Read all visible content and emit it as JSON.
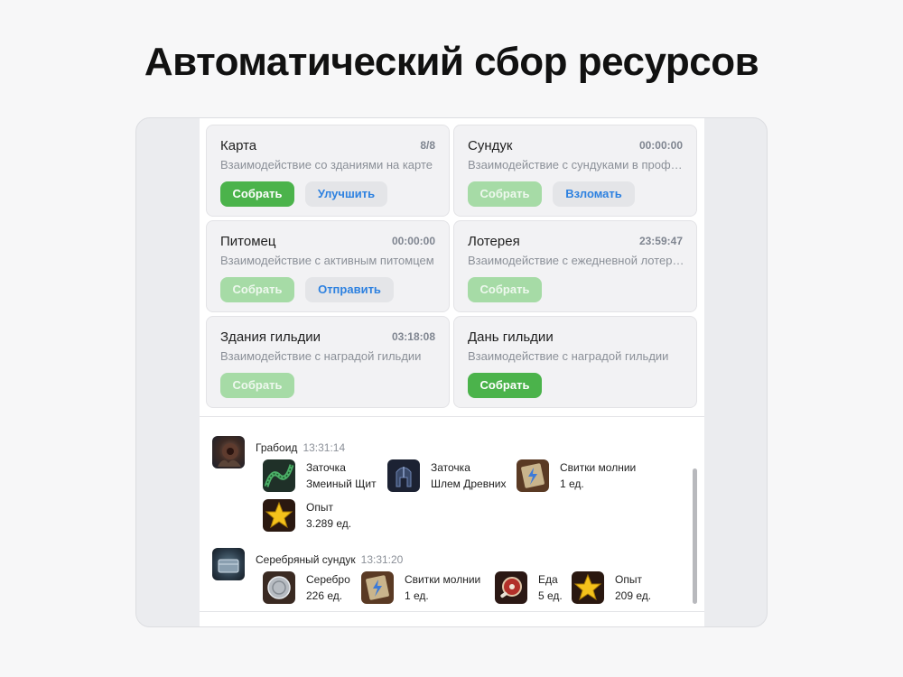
{
  "headline": "Автоматический сбор ресурсов",
  "cards": [
    {
      "title": "Карта",
      "meta": "8/8",
      "desc": "Взаимодействие со зданиями на карте",
      "primary": "Собрать",
      "secondary": "Улучшить"
    },
    {
      "title": "Сундук",
      "meta": "00:00:00",
      "desc": "Взаимодействие с сундуками в профиле",
      "primary": "Собрать",
      "secondary": "Взломать"
    },
    {
      "title": "Питомец",
      "meta": "00:00:00",
      "desc": "Взаимодействие с активным питомцем",
      "primary": "Собрать",
      "secondary": "Отправить"
    },
    {
      "title": "Лотерея",
      "meta": "23:59:47",
      "desc": "Взаимодействие с ежедневной лотереей",
      "primary": "Собрать"
    },
    {
      "title": "Здания гильдии",
      "meta": "03:18:08",
      "desc": "Взаимодействие с наградой гильдии",
      "primary": "Собрать"
    },
    {
      "title": "Дань гильдии",
      "meta": "",
      "desc": "Взаимодействие с наградой гильдии",
      "primary": "Собрать"
    }
  ],
  "log": [
    {
      "name": "Грабоид",
      "time": "13:31:14",
      "items": [
        {
          "name": "Заточка",
          "sub": "Змеиный Щит",
          "icon": "snake-shield-icon"
        },
        {
          "name": "Заточка",
          "sub": "Шлем Древних",
          "icon": "ancient-helmet-icon"
        },
        {
          "name": "Свитки молнии",
          "sub": "1 ед.",
          "icon": "lightning-scroll-icon"
        },
        {
          "name": "Опыт",
          "sub": "3.289 ед.",
          "icon": "star-icon"
        }
      ]
    },
    {
      "name": "Серебряный сундук",
      "time": "13:31:20",
      "items": [
        {
          "name": "Серебро",
          "sub": "226 ед.",
          "icon": "silver-coin-icon"
        },
        {
          "name": "Свитки молнии",
          "sub": "1 ед.",
          "icon": "lightning-scroll-icon"
        },
        {
          "name": "Еда",
          "sub": "5 ед.",
          "icon": "meat-icon"
        },
        {
          "name": "Опыт",
          "sub": "209 ед.",
          "icon": "star-icon"
        }
      ]
    }
  ],
  "colors": {
    "accent": "#4bb34b",
    "accent_disabled": "#a6dba6",
    "link": "#2d81e0"
  }
}
